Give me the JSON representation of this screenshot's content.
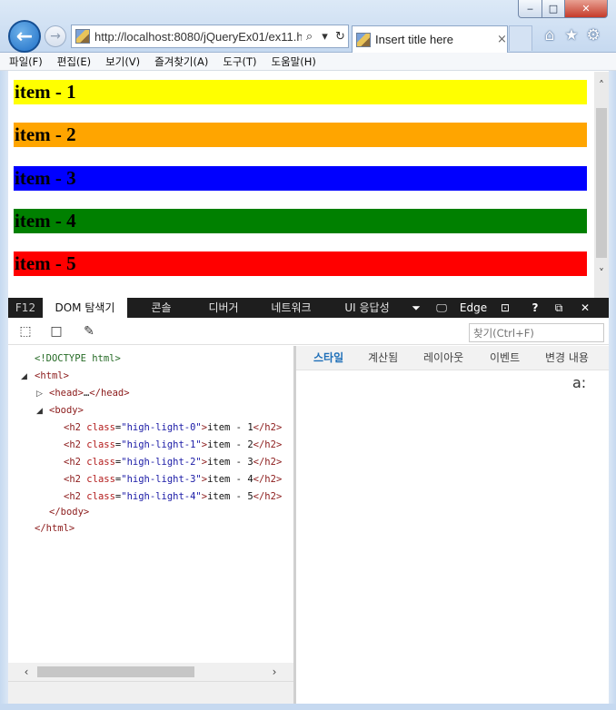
{
  "window": {
    "minimize_label": "‒",
    "maximize_label": "□",
    "close_label": "✕"
  },
  "browser": {
    "back_label": "←",
    "forward_label": "→",
    "address": "http://localhost:8080/jQueryEx01/ex11.ht",
    "search_glyph": "⌕",
    "refresh_glyph": "↻",
    "tab_title": "Insert title here",
    "tab_close": "×",
    "home_glyph": "⌂",
    "favorites_glyph": "★",
    "settings_glyph": "⚙"
  },
  "menubar": {
    "items": [
      "파일(F)",
      "편집(E)",
      "보기(V)",
      "즐겨찾기(A)",
      "도구(T)",
      "도움말(H)"
    ]
  },
  "page": {
    "items": [
      {
        "label": "item - 1",
        "color": "#ffff00"
      },
      {
        "label": "item - 2",
        "color": "#ffa500"
      },
      {
        "label": "item - 3",
        "color": "#0000ff"
      },
      {
        "label": "item - 4",
        "color": "#008000"
      },
      {
        "label": "item - 5",
        "color": "#ff0000"
      }
    ],
    "scroll_up": "˄",
    "scroll_down": "˅"
  },
  "devtools": {
    "tabs": {
      "f12": "F12",
      "dom": "DOM 탐색기",
      "console": "콘솔",
      "debugger": "디버거",
      "network": "네트워크",
      "ui_responsiveness": "UI 응답성"
    },
    "emulation_label": "Edge",
    "help_label": "?",
    "find_placeholder": "찾기(Ctrl+F)",
    "tree": {
      "doctype": "<!DOCTYPE html>",
      "html_open": "html",
      "head": "head",
      "head_ellipsis": "…",
      "body_open": "body",
      "h2_rows": [
        {
          "class_value": "high-light-0",
          "text": "item - 1"
        },
        {
          "class_value": "high-light-1",
          "text": "item - 2"
        },
        {
          "class_value": "high-light-2",
          "text": "item - 3"
        },
        {
          "class_value": "high-light-3",
          "text": "item - 4"
        },
        {
          "class_value": "high-light-4",
          "text": "item - 5"
        }
      ],
      "body_close": "</body>",
      "html_close": "</html>"
    },
    "style_tabs": {
      "styles": "스타일",
      "computed": "계산됨",
      "layout": "레이아웃",
      "events": "이벤트",
      "changes": "변경 내용"
    },
    "hover_toggle": "a:"
  }
}
